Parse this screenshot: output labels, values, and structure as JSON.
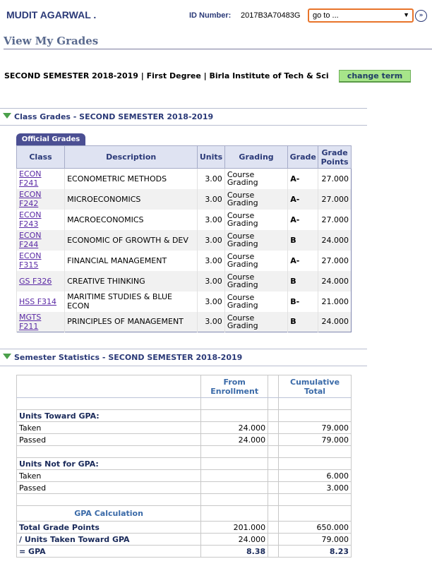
{
  "header": {
    "user_name": "MUDIT AGARWAL .",
    "id_label": "ID Number:",
    "id_value": "2017B3A70483G",
    "goto_value": "go to ...",
    "goto_arrow": "▼",
    "go_button": "»"
  },
  "page_title": "View My Grades",
  "term": {
    "text": "SECOND SEMESTER 2018-2019 | First Degree | Birla Institute of Tech & Sci",
    "change_label": "change term"
  },
  "class_grades": {
    "section_title": "Class Grades - SECOND SEMESTER 2018-2019",
    "tab_label": "Official Grades",
    "columns": [
      "Class",
      "Description",
      "Units",
      "Grading",
      "Grade",
      "Grade Points"
    ],
    "rows": [
      {
        "class": "ECON F241",
        "class_l1": "ECON",
        "class_l2": "F241",
        "description": "ECONOMETRIC METHODS",
        "units": "3.00",
        "grading": "Course Grading",
        "grade": "A-",
        "points": "27.000"
      },
      {
        "class": "ECON F242",
        "class_l1": "ECON",
        "class_l2": "F242",
        "description": "MICROECONOMICS",
        "units": "3.00",
        "grading": "Course Grading",
        "grade": "A-",
        "points": "27.000"
      },
      {
        "class": "ECON F243",
        "class_l1": "ECON",
        "class_l2": "F243",
        "description": "MACROECONOMICS",
        "units": "3.00",
        "grading": "Course Grading",
        "grade": "A-",
        "points": "27.000"
      },
      {
        "class": "ECON F244",
        "class_l1": "ECON",
        "class_l2": "F244",
        "description": "ECONOMIC OF GROWTH & DEV",
        "units": "3.00",
        "grading": "Course Grading",
        "grade": "B",
        "points": "24.000"
      },
      {
        "class": "ECON F315",
        "class_l1": "ECON",
        "class_l2": "F315",
        "description": "FINANCIAL MANAGEMENT",
        "units": "3.00",
        "grading": "Course Grading",
        "grade": "A-",
        "points": "27.000"
      },
      {
        "class": "GS F326",
        "class_l1": "GS F326",
        "class_l2": "",
        "description": "CREATIVE THINKING",
        "units": "3.00",
        "grading": "Course Grading",
        "grade": "B",
        "points": "24.000"
      },
      {
        "class": "HSS F314",
        "class_l1": "HSS F314",
        "class_l2": "",
        "description": "MARITIME STUDIES & BLUE ECON",
        "units": "3.00",
        "grading": "Course Grading",
        "grade": "B-",
        "points": "21.000"
      },
      {
        "class": "MGTS F211",
        "class_l1": "MGTS",
        "class_l2": "F211",
        "description": "PRINCIPLES OF MANAGEMENT",
        "units": "3.00",
        "grading": "Course Grading",
        "grade": "B",
        "points": "24.000"
      }
    ]
  },
  "semester_stats": {
    "section_title": "Semester Statistics - SECOND SEMESTER 2018-2019",
    "col_enrollment": "From Enrollment",
    "col_cumulative": "Cumulative Total",
    "gpa_units_title": "Units Toward GPA:",
    "gpa_taken_label": "Taken",
    "gpa_taken_enr": "24.000",
    "gpa_taken_cum": "79.000",
    "gpa_passed_label": "Passed",
    "gpa_passed_enr": "24.000",
    "gpa_passed_cum": "79.000",
    "nongpa_title": "Units Not for GPA:",
    "nongpa_taken_label": "Taken",
    "nongpa_taken_cum": "6.000",
    "nongpa_passed_label": "Passed",
    "nongpa_passed_cum": "3.000",
    "gpa_calc_title": "GPA Calculation",
    "tgp_label": "Total Grade Points",
    "tgp_enr": "201.000",
    "tgp_cum": "650.000",
    "units_gpa_label": "/  Units Taken Toward GPA",
    "units_gpa_enr": "24.000",
    "units_gpa_cum": "79.000",
    "gpa_label": "= GPA",
    "gpa_enr": "8.38",
    "gpa_cum": "8.23"
  }
}
